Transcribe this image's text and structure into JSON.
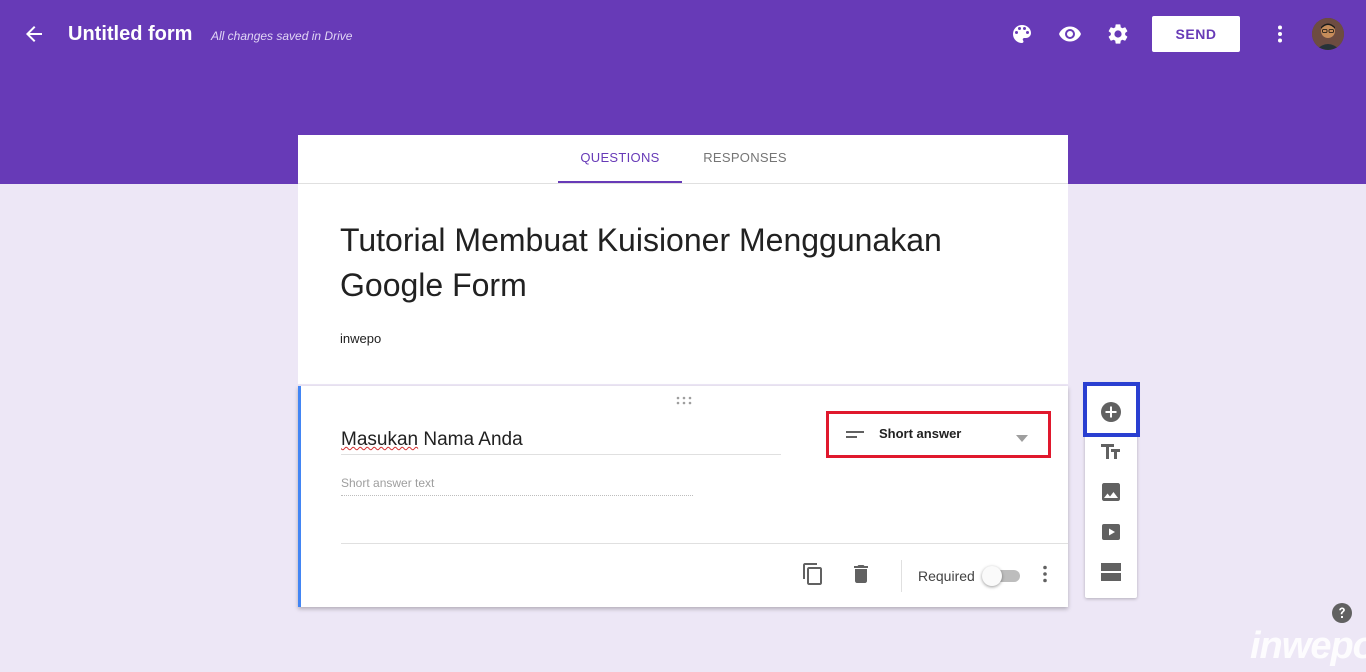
{
  "header": {
    "form_name": "Untitled form",
    "save_status": "All changes saved in Drive",
    "send_label": "SEND",
    "icons": [
      "back-arrow-icon",
      "palette-icon",
      "eye-icon",
      "gear-icon",
      "more-vert-icon"
    ]
  },
  "tabs": [
    {
      "label": "QUESTIONS",
      "active": true
    },
    {
      "label": "RESPONSES",
      "active": false
    }
  ],
  "form": {
    "title": "Tutorial Membuat Kuisioner Menggunakan Google Form",
    "description": "inwepo"
  },
  "question": {
    "title_prefix": "Masukan",
    "title_rest": " Nama Anda",
    "answer_placeholder": "Short answer text",
    "type_label": "Short answer",
    "required_label": "Required",
    "required": false
  },
  "side_toolbar": {
    "items": [
      "add-question-icon",
      "title-text-icon",
      "image-icon",
      "video-icon",
      "section-icon"
    ]
  },
  "colors": {
    "header": "#673ab7",
    "background": "#ede7f6",
    "accent": "#673ab7",
    "question_bar": "#4285f4",
    "type_highlight": "#e0182d",
    "toolbar_highlight": "#2a3fd1"
  },
  "watermark": "inwepo"
}
